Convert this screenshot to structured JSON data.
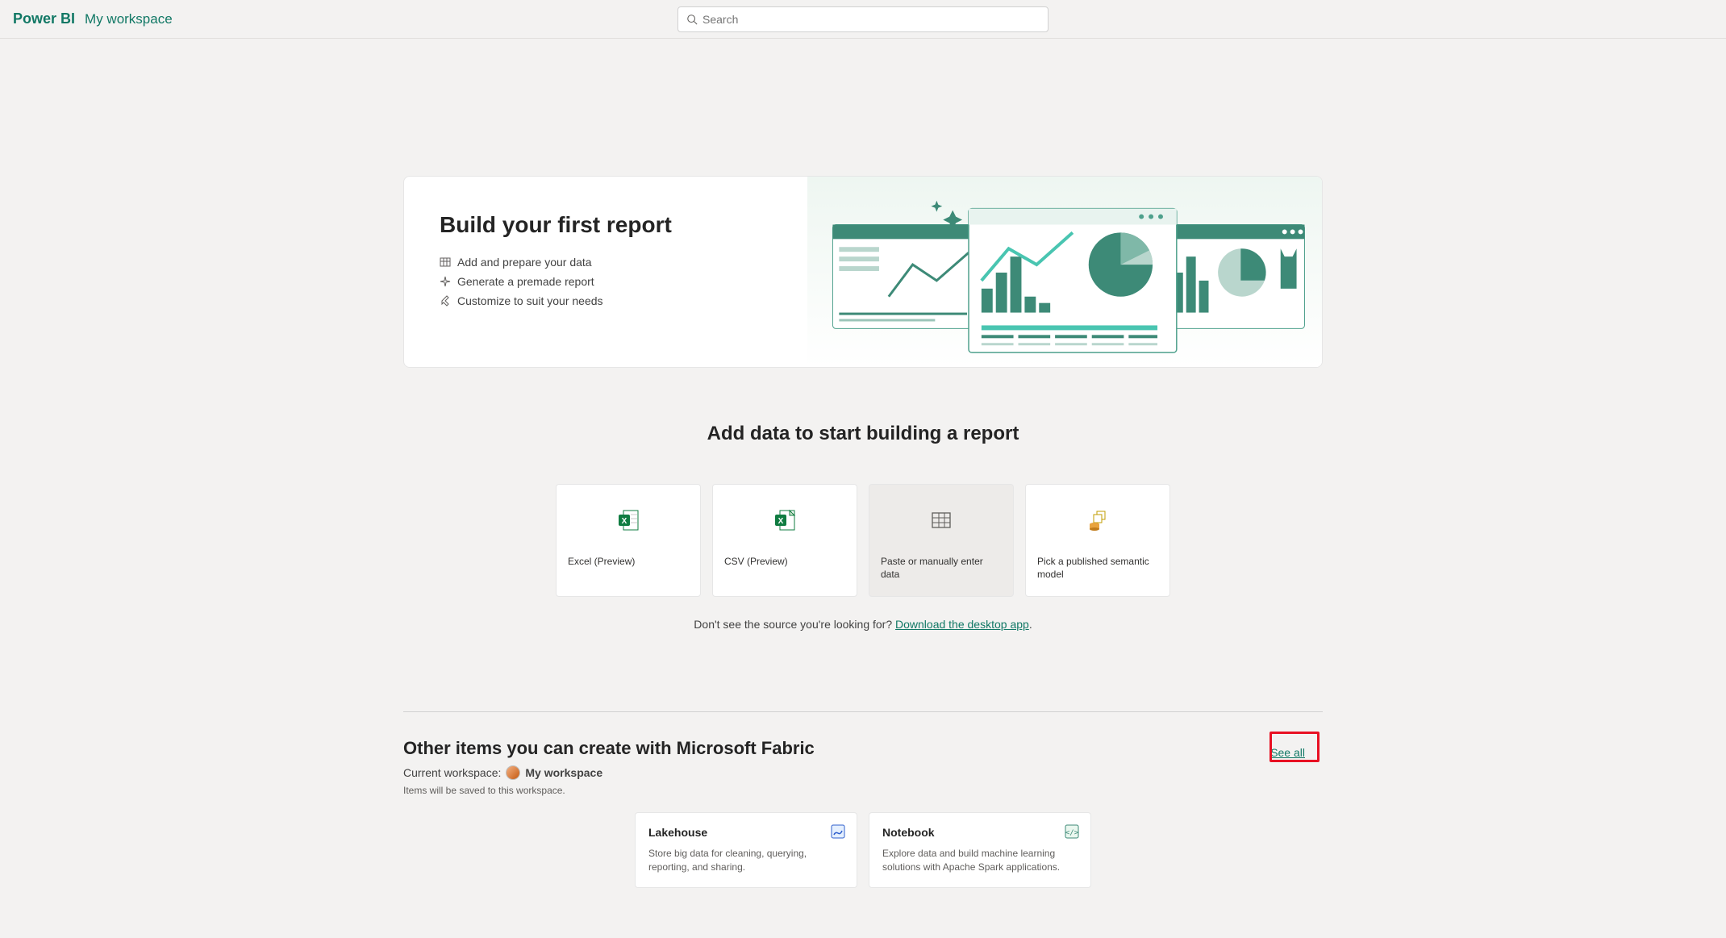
{
  "header": {
    "brand": "Power BI",
    "workspace": "My workspace",
    "search_placeholder": "Search"
  },
  "hero": {
    "title": "Build your first report",
    "bullets": [
      "Add and prepare your data",
      "Generate a premade report",
      "Customize to suit your needs"
    ]
  },
  "add_data": {
    "title": "Add data to start building a report",
    "sources": [
      {
        "label": "Excel (Preview)"
      },
      {
        "label": "CSV (Preview)"
      },
      {
        "label": "Paste or manually enter data"
      },
      {
        "label": "Pick a published semantic model"
      }
    ],
    "not_found_prefix": "Don't see the source you're looking for? ",
    "download_link": "Download the desktop app",
    "period": "."
  },
  "fabric": {
    "title": "Other items you can create with Microsoft Fabric",
    "current_workspace_label": "Current workspace:",
    "current_workspace_name": "My workspace",
    "note": "Items will be saved to this workspace.",
    "see_all": "See all",
    "cards": [
      {
        "title": "Lakehouse",
        "desc": "Store big data for cleaning, querying, reporting, and sharing."
      },
      {
        "title": "Notebook",
        "desc": "Explore data and build machine learning solutions with Apache Spark applications."
      }
    ]
  }
}
